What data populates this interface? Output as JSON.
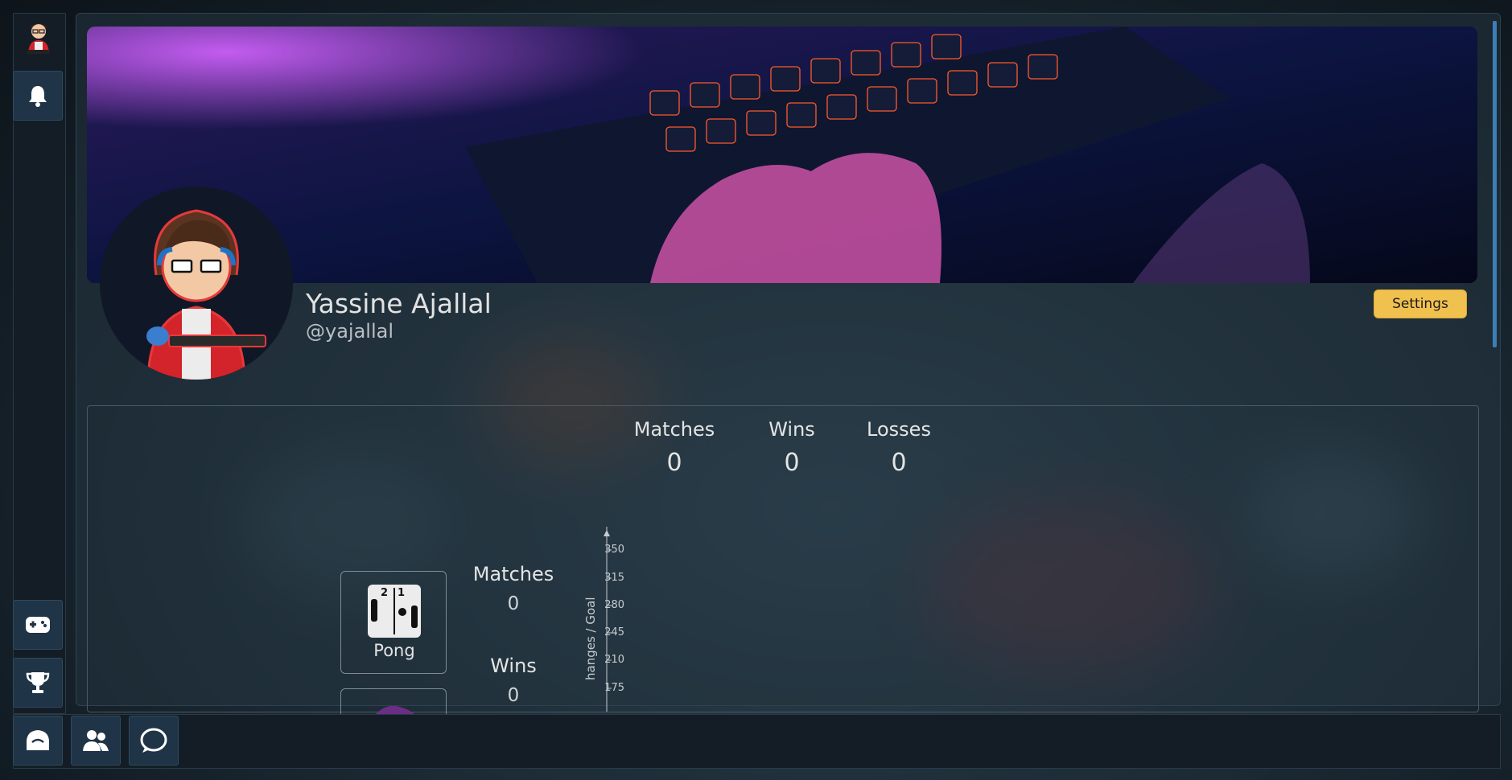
{
  "profile": {
    "name": "Yassine Ajallal",
    "handle": "@yajallal",
    "settings_label": "Settings"
  },
  "overall_stats": [
    {
      "label": "Matches",
      "value": "0"
    },
    {
      "label": "Wins",
      "value": "0"
    },
    {
      "label": "Losses",
      "value": "0"
    }
  ],
  "game": {
    "name": "Pong",
    "icon": "pong-icon",
    "stats": [
      {
        "label": "Matches",
        "value": "0"
      },
      {
        "label": "Wins",
        "value": "0"
      }
    ]
  },
  "chart": {
    "axis_label": "hanges / Goal",
    "ticks": [
      "350",
      "315",
      "280",
      "245",
      "210",
      "175"
    ]
  },
  "sidebar": {
    "items": [
      "avatar",
      "notifications-icon",
      "game-controller-icon",
      "trophy-icon"
    ]
  },
  "bottombar": {
    "items": [
      "home-icon",
      "friends-icon",
      "chat-icon"
    ]
  },
  "colors": {
    "accent": "#f1c14f",
    "panel": "#141d25",
    "button": "#1f3446",
    "scroll": "#3c7fb8"
  }
}
